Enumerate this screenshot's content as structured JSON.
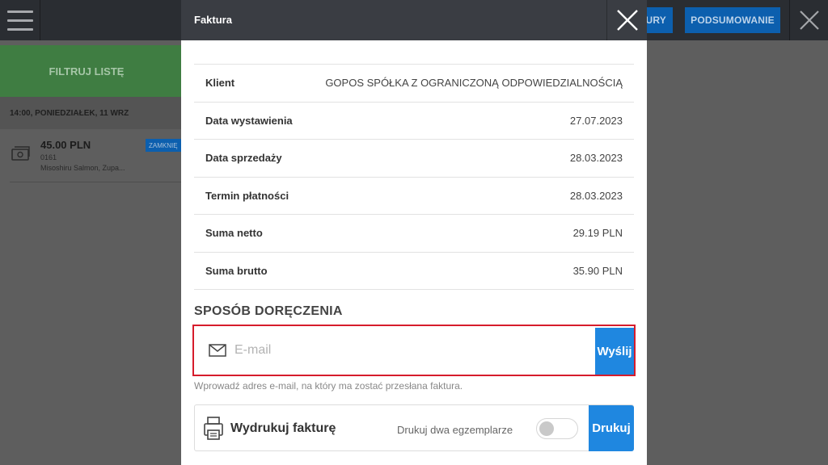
{
  "background": {
    "top_buttons": [
      "URY",
      "PODSUMOWANIE"
    ],
    "filter_label": "FILTRUJ LISTĘ",
    "date_header": "14:00, PONIEDZIAŁEK, 11 WRZ",
    "order": {
      "amount": "45.00 PLN",
      "number": "0161",
      "items": "Misoshiru Salmon, Zupa...",
      "badge": "ZAMKNIĘ"
    }
  },
  "modal": {
    "title": "Faktura",
    "details": [
      {
        "label": "Klient",
        "value": "GOPOS SPÓŁKA Z OGRANICZONĄ ODPOWIEDZIALNOŚCIĄ"
      },
      {
        "label": "Data wystawienia",
        "value": "27.07.2023"
      },
      {
        "label": "Data sprzedaży",
        "value": "28.03.2023"
      },
      {
        "label": "Termin płatności",
        "value": "28.03.2023"
      },
      {
        "label": "Suma netto",
        "value": "29.19 PLN"
      },
      {
        "label": "Suma brutto",
        "value": "35.90 PLN"
      }
    ],
    "delivery_title": "SPOSÓB DORĘCZENIA",
    "email": {
      "value": "",
      "placeholder": "E-mail",
      "send_label": "Wyślij",
      "helper": "Wprowadź adres e-mail, na który ma zostać przesłana faktura."
    },
    "print": {
      "label": "Wydrukuj fakturę",
      "copies_label": "Drukuj dwa egzemplarze",
      "copies_enabled": false,
      "button_label": "Drukuj"
    }
  },
  "colors": {
    "accent": "#1f87e0",
    "highlight_border": "#d61c2c",
    "filter_green": "#3f7d42",
    "header_dark": "#3a3d43"
  }
}
